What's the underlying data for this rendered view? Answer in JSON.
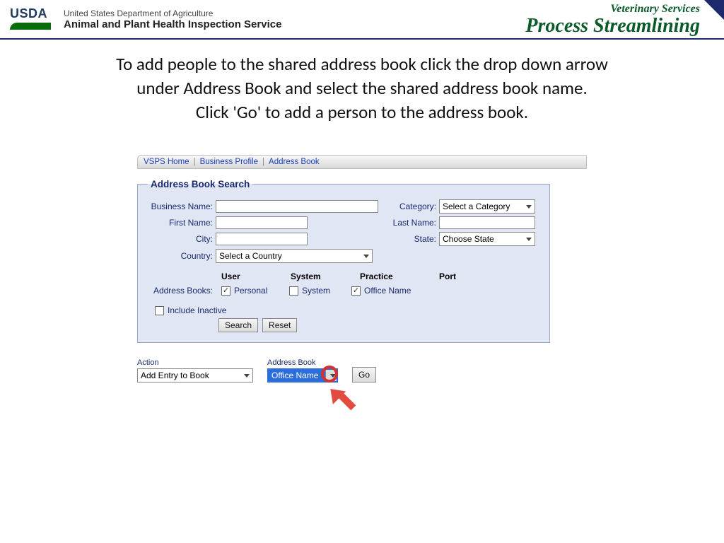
{
  "header": {
    "usda": "USDA",
    "dept_line1": "United States Department of Agriculture",
    "dept_line2": "Animal and Plant Health Inspection Service",
    "vs": "Veterinary Services",
    "ps": "Process Streamlining"
  },
  "instruction": {
    "line1": "To add people to the shared address book click the drop down arrow",
    "line2": "under Address Book and select the shared address book name.",
    "line3": "Click 'Go' to add a person to the address book."
  },
  "tabs": {
    "home": "VSPS Home",
    "business": "Business Profile",
    "address": "Address Book"
  },
  "search": {
    "legend": "Address Book Search",
    "labels": {
      "business_name": "Business Name:",
      "category": "Category:",
      "first_name": "First Name:",
      "last_name": "Last Name:",
      "city": "City:",
      "state": "State:",
      "country": "Country:",
      "address_books": "Address Books:",
      "include_inactive": "Include Inactive"
    },
    "selects": {
      "category": "Select a Category",
      "state": "Choose State",
      "country": "Select a Country"
    },
    "book_headers": {
      "user": "User",
      "system": "System",
      "practice": "Practice",
      "port": "Port"
    },
    "book_options": {
      "personal": {
        "label": "Personal",
        "checked": true
      },
      "system": {
        "label": "System",
        "checked": false
      },
      "office": {
        "label": "Office Name",
        "checked": true
      }
    },
    "include_inactive_checked": false,
    "buttons": {
      "search": "Search",
      "reset": "Reset"
    }
  },
  "action": {
    "action_label": "Action",
    "action_value": "Add Entry to Book",
    "book_label": "Address Book",
    "book_value": "Office Name",
    "go": "Go"
  }
}
